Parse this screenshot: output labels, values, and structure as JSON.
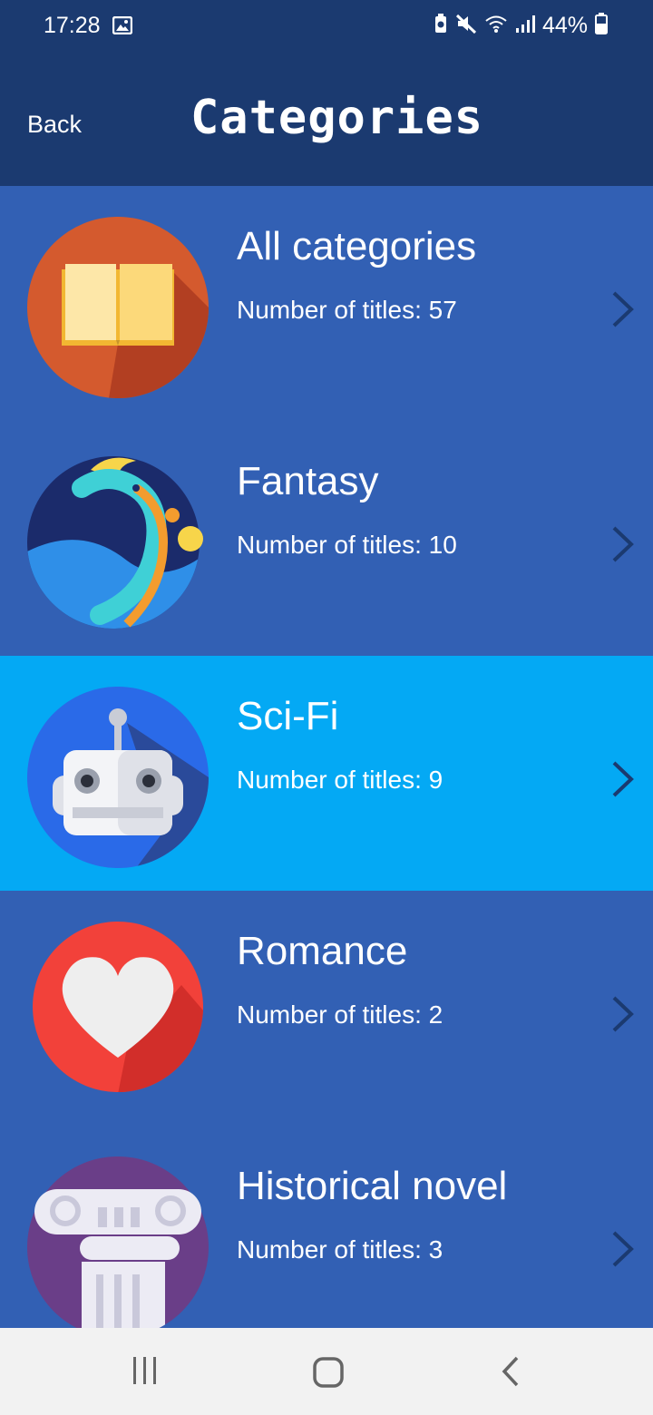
{
  "status_bar": {
    "time": "17:28",
    "battery_percent": "44%",
    "icons": [
      "image-icon",
      "battery-saver-icon",
      "mute-icon",
      "wifi-icon",
      "signal-icon",
      "battery-icon"
    ]
  },
  "header": {
    "back_label": "Back",
    "title": "Categories",
    "background": "#1b3a70"
  },
  "categories": [
    {
      "title": "All categories",
      "count_label": "Number of titles: 57",
      "icon": "open-book-icon",
      "selected": false
    },
    {
      "title": "Fantasy",
      "count_label": "Number of titles: 10",
      "icon": "dragon-icon",
      "selected": false
    },
    {
      "title": "Sci-Fi",
      "count_label": "Number of titles: 9",
      "icon": "robot-icon",
      "selected": true
    },
    {
      "title": "Romance",
      "count_label": "Number of titles: 2",
      "icon": "heart-icon",
      "selected": false
    },
    {
      "title": "Historical novel",
      "count_label": "Number of titles: 3",
      "icon": "column-icon",
      "selected": false
    }
  ],
  "colors": {
    "row_background": "#3260b4",
    "selected_row_background": "#04a9f4",
    "chevron": "#1b3a70"
  },
  "nav_bar": {
    "buttons": [
      "recents-icon",
      "home-icon",
      "back-nav-icon"
    ]
  }
}
